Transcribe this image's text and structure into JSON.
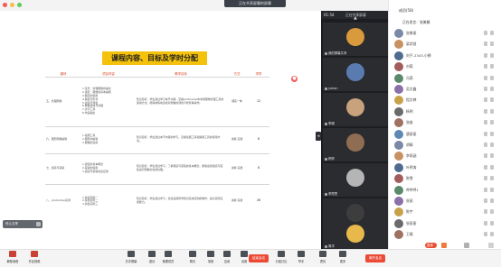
{
  "window": {
    "banner_title": "正在共享屏幕的屏幕"
  },
  "share": {
    "timer": "01:54",
    "label": "正在共享屏幕"
  },
  "slide": {
    "title": "课程内容、目标及学时分配",
    "headers": [
      "模块",
      "项目内容",
      "教学目标",
      "方式",
      "学时"
    ],
    "rows": [
      {
        "module": "五、处理图像",
        "items": [
          "1.任务：处理图像的美化",
          "2.选区：图像的基本编辑",
          "3.图层的使用",
          "4.路径与形状",
          "5.滤镜与调色",
          "6.图像合成与处理",
          "7.文字工具",
          "8.作品输出"
        ],
        "goal": "知识目标：学生通过学习本节内容，掌握photoshop中常用图像处理工具的使用方法，能够熟练地完成对图像的调色与修复等操作。",
        "mode": "理实一体",
        "hours": "12"
      },
      {
        "module": "六、图形图像编辑",
        "items": [
          "1.绘图工具",
          "2.图形的编辑",
          "3.图像的变换"
        ],
        "goal": "知识目标：学生通过本节内容的学习，掌握绘图工具和编辑工具的使用方法。",
        "mode": "讲授 实践",
        "hours": "6"
      },
      {
        "module": "七、通道与蒙版",
        "items": [
          "1.通道的基本概念",
          "2.蒙版的使用",
          "3.通道与蒙版综合应用"
        ],
        "goal": "知识目标：学生通过学习，了解通道与蒙版的基本概念，能够运用通道与蒙版进行图像的合成处理。",
        "mode": "讲授 实践",
        "hours": "6"
      },
      {
        "module": "八、photoshop实例",
        "items": [
          "1.综合实例一",
          "2.综合实例二",
          "3.综合实例三"
        ],
        "goal": "知识目标：学生通过学习，综合运用所学知识完成实例的制作，提高实际应用能力。",
        "mode": "讲授 实践",
        "hours": "26"
      }
    ]
  },
  "share_toolbar": {
    "label": "停止共享"
  },
  "participants_tiles": [
    {
      "name": "我的屏幕共享"
    },
    {
      "name": "yuhan"
    },
    {
      "name": "李娟"
    },
    {
      "name": "婷婷"
    },
    {
      "name": "李思思"
    },
    {
      "name": "张小"
    },
    {
      "name": "周洋"
    }
  ],
  "panel": {
    "header": "成员(58)",
    "search_tab": "正在发言：张美娟",
    "members": [
      "张美丽",
      "梁欣慧",
      "刘子-2343-小狮",
      "刘萌",
      "冯燕",
      "吴文鑫",
      "程文婷",
      "杨明",
      "张维",
      "唐丽丽",
      "胡晴",
      "李雨涵",
      "叶明涛",
      "陈雪",
      "呼呼呼1",
      "张丽",
      "陈宇",
      "张丽丽",
      "王晴"
    ],
    "invite_label": "邀请"
  },
  "toolbar": {
    "buttons": [
      "解除静音",
      "开启视频",
      "共享屏幕",
      "邀请",
      "管理成员",
      "聊天",
      "录制",
      "应用",
      "设置",
      "分组讨论",
      "举手",
      "表情",
      "更多"
    ],
    "end_label": "结束会议",
    "leave_label": "离开会议"
  }
}
